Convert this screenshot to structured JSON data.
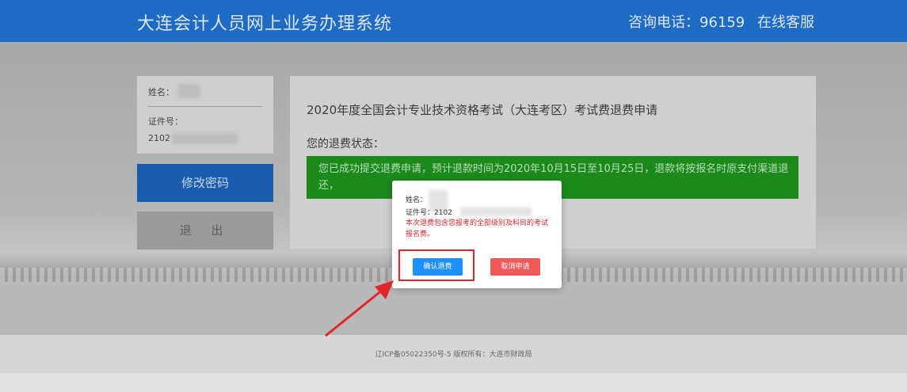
{
  "header": {
    "title": "大连会计人员网上业务办理系统",
    "hotline": "咨询电话：96159",
    "online_service": "在线客服"
  },
  "sidebar": {
    "name_label": "姓名：",
    "id_label": "证件号：",
    "id_value": "2102",
    "change_password_label": "修改密码",
    "logout_label": "退 出"
  },
  "main": {
    "title": "2020年度全国会计专业技术资格考试（大连考区）考试费退费申请",
    "status_label": "您的退费状态：",
    "status_text": "您已成功提交退费申请，预计退款时间为2020年10月15日至10月25日，退款将按报名时原支付渠道退还，"
  },
  "modal": {
    "name_label": "姓名：",
    "id_label": "证件号：2102",
    "notice": "本次退费包含您报考的全部级别及科目的考试报名费。",
    "confirm_label": "确认退费",
    "cancel_label": "取消申请"
  },
  "footer": {
    "text": "辽ICP备05022350号-5   版权所有：大连市财政局"
  },
  "colors": {
    "header_bg": "#1f6bc4",
    "primary_button": "#1e90ff",
    "danger_button": "#f05959",
    "status_bg": "#1b8a1b",
    "annotation": "#e0262b"
  }
}
